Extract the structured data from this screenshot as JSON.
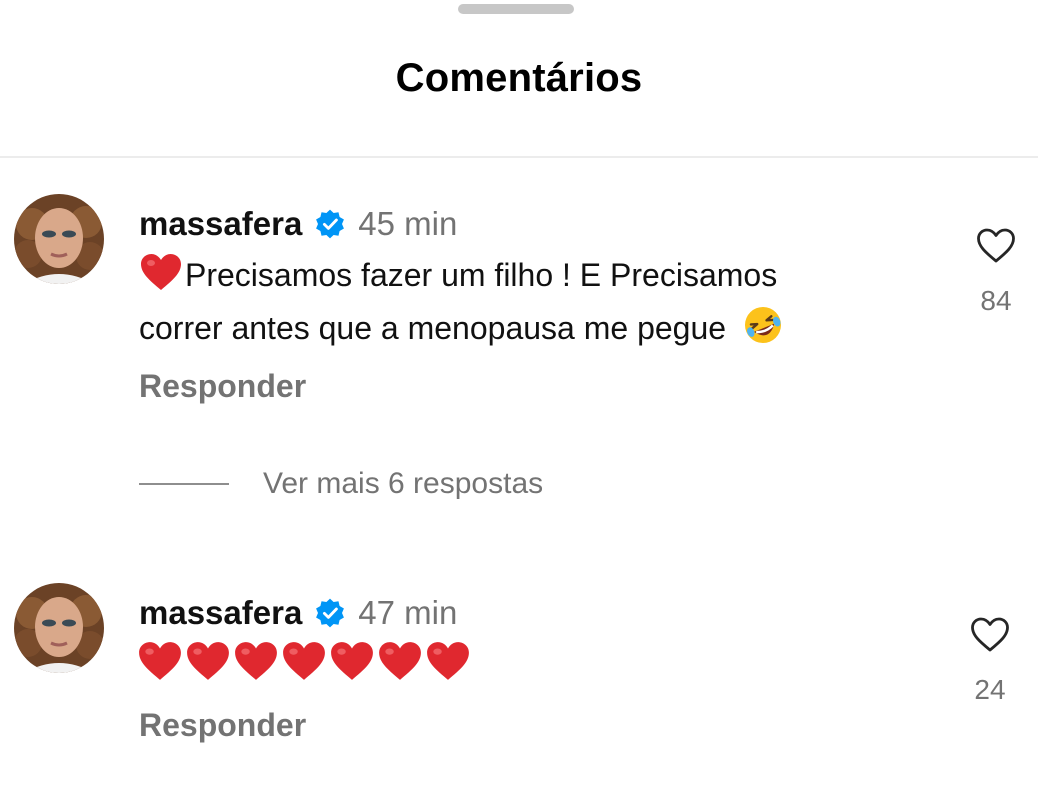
{
  "sheet": {
    "title": "Comentários"
  },
  "comments": [
    {
      "username": "massafera",
      "verified": true,
      "time": "45 min",
      "text_line1": "Precisamos fazer um filho ! E Precisamos",
      "text_line2": "correr antes que a menopausa me pegue",
      "leading_emoji": "red-heart",
      "trailing_emoji": "rolling-on-the-floor-laughing",
      "reply_label": "Responder",
      "likes": "84",
      "view_replies_label": "Ver mais 6 respostas"
    },
    {
      "username": "massafera",
      "verified": true,
      "time": "47 min",
      "emoji_sequence": [
        "red-heart",
        "red-heart",
        "red-heart",
        "red-heart",
        "red-heart",
        "red-heart",
        "red-heart"
      ],
      "reply_label": "Responder",
      "likes": "24"
    }
  ],
  "icons": {
    "like": "heart-outline-icon",
    "verified": "verified-badge-icon"
  },
  "colors": {
    "verified_blue": "#0095f6",
    "secondary_text": "#737373",
    "heart_red": "#e0282f",
    "divider": "#ececec"
  }
}
